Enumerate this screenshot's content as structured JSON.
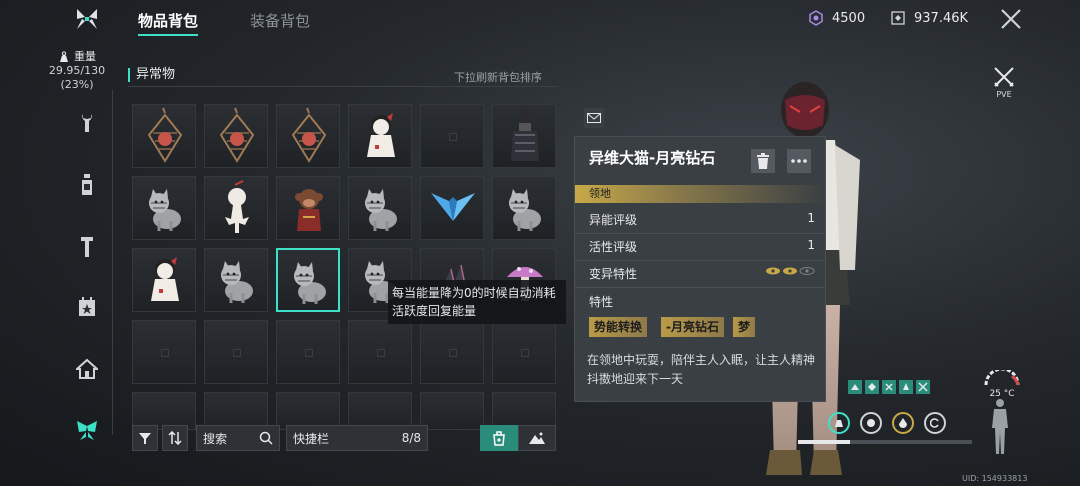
{
  "header": {
    "tabs": [
      {
        "label": "物品背包",
        "active": true
      },
      {
        "label": "装备背包",
        "active": false
      }
    ],
    "currency_crystal": "4500",
    "currency_coins": "937.46K"
  },
  "weight": {
    "label": "重量",
    "value": "29.95/130",
    "percent": "(23%)"
  },
  "nav": {
    "items": [
      "wrench-icon",
      "bottle-icon",
      "tool-icon",
      "calendar-star-icon",
      "house-icon",
      "butterfly-icon"
    ],
    "active_item": "butterfly-icon"
  },
  "inventory": {
    "category_title": "异常物",
    "sort_hint": "下拉刷新背包排序",
    "slots": [
      {
        "icon": "lantern-icon"
      },
      {
        "icon": "lantern-icon"
      },
      {
        "icon": "lantern-icon"
      },
      {
        "icon": "doll-icon"
      },
      {
        "icon": ""
      },
      {
        "icon": "samurai-icon"
      },
      {
        "icon": "cat-icon"
      },
      {
        "icon": "white-doll-icon"
      },
      {
        "icon": "monkey-icon"
      },
      {
        "icon": "cat-icon"
      },
      {
        "icon": "blue-wings-icon"
      },
      {
        "icon": "cat-icon"
      },
      {
        "icon": "doll-icon"
      },
      {
        "icon": "cat-icon"
      },
      {
        "icon": "cat-icon",
        "selected": true
      },
      {
        "icon": "cat-icon"
      },
      {
        "icon": "crystal-icon"
      },
      {
        "icon": "mushroom-icon"
      },
      {
        "icon": ""
      },
      {
        "icon": ""
      },
      {
        "icon": ""
      },
      {
        "icon": ""
      },
      {
        "icon": ""
      },
      {
        "icon": ""
      },
      {
        "icon": ""
      },
      {
        "icon": ""
      },
      {
        "icon": ""
      },
      {
        "icon": ""
      },
      {
        "icon": ""
      },
      {
        "icon": ""
      }
    ],
    "tooltip": "每当能量降为0的时候自动消耗活跃度回复能量"
  },
  "controls": {
    "search_label": "搜索",
    "quickbar_label": "快捷栏",
    "quickbar_count": "8/8"
  },
  "detail": {
    "title": "异维大猫-月亮钻石",
    "tag": "领地",
    "rows": [
      {
        "label": "异能评级",
        "value": "1"
      },
      {
        "label": "活性评级",
        "value": "1"
      },
      {
        "label": "变异特性",
        "value": ""
      }
    ],
    "traits_label": "特性",
    "chips": [
      "势能转换",
      "-月亮钻石",
      "梦"
    ],
    "description": "在领地中玩耍，陪伴主人入眠，让主人精神抖擞地迎来下一天"
  },
  "right": {
    "mode_label": "PVE",
    "temperature": "25 °C",
    "uid": "UID: 154933813",
    "energy_progress": 0.3
  },
  "colors": {
    "accent": "#3fe0c8",
    "gold": "#c8a948",
    "status_teal": "#2a8c7a"
  }
}
